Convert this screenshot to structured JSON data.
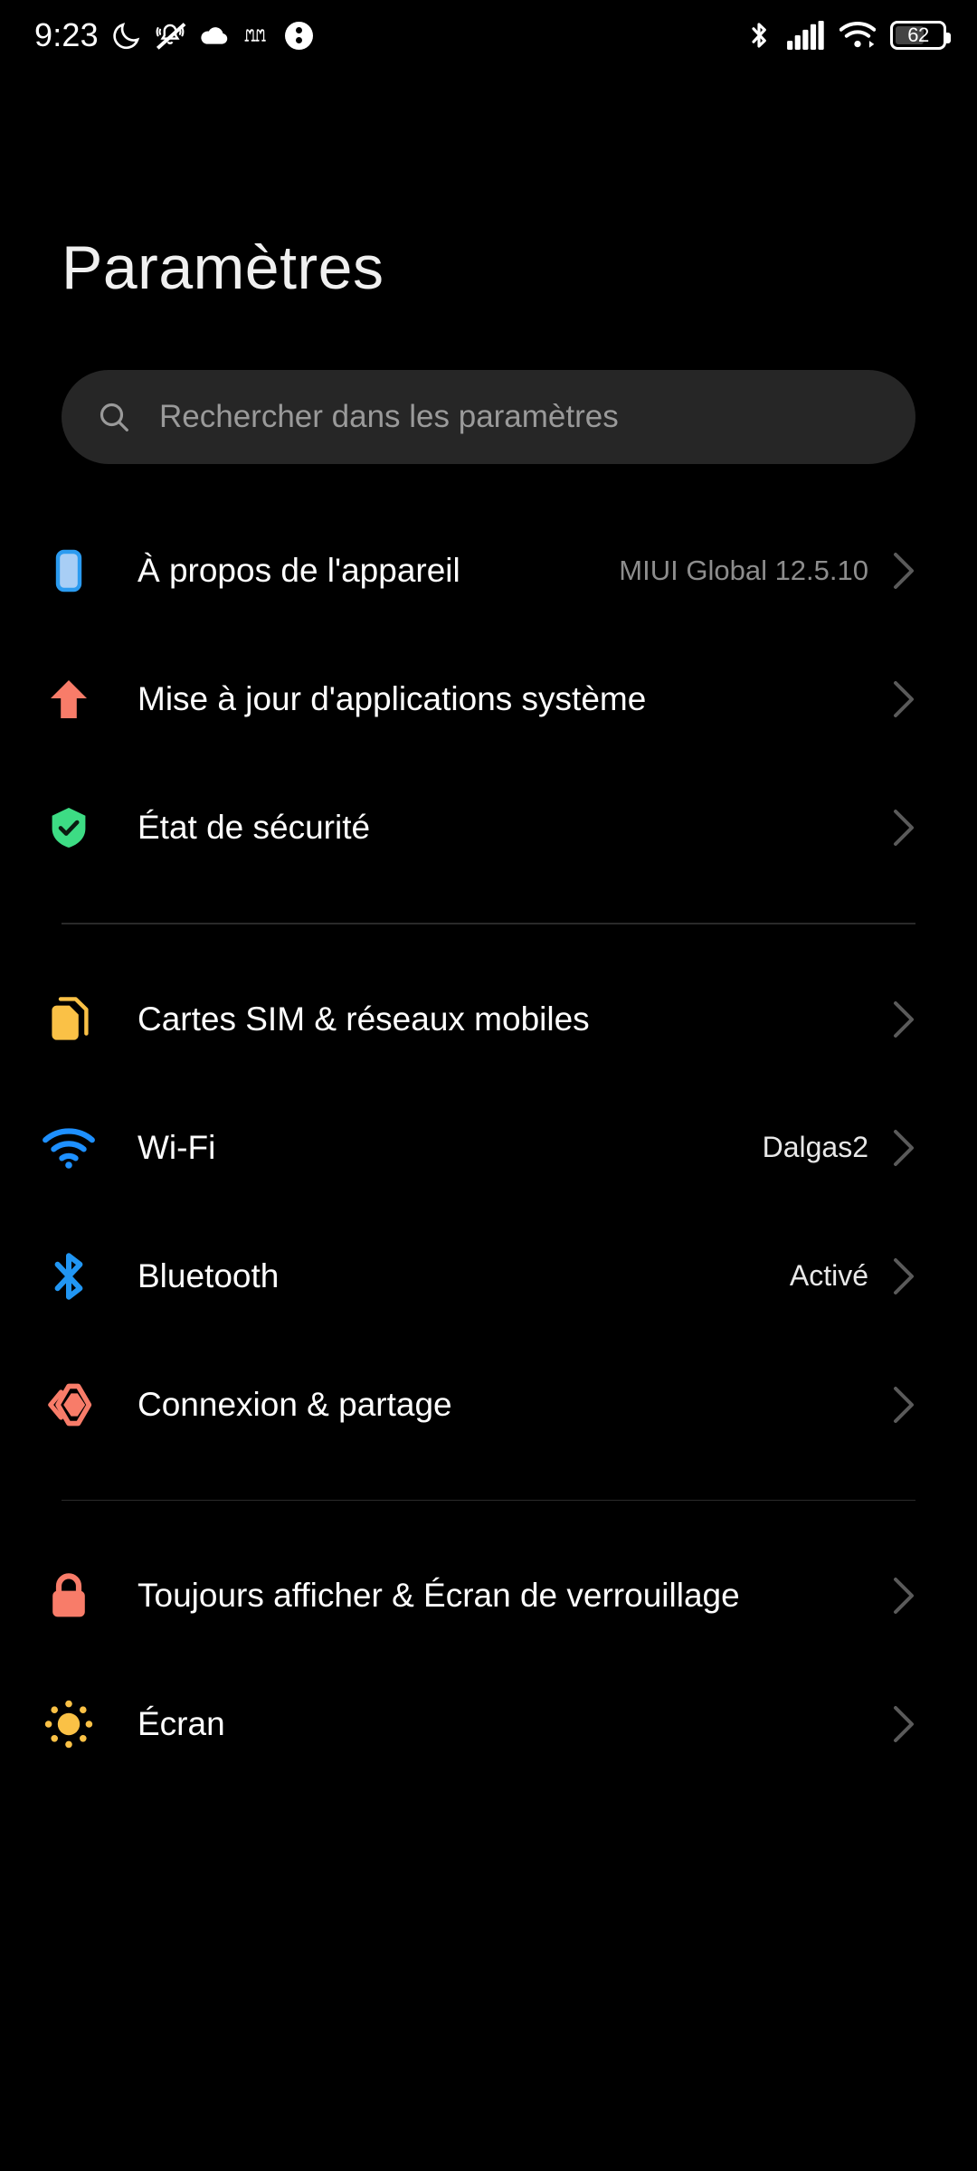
{
  "statusbar": {
    "time": "9:23",
    "battery_level": "62",
    "left_icons": [
      {
        "name": "moon-icon",
        "glyph": "☾"
      },
      {
        "name": "vibrate-off-icon",
        "glyph": "🔔"
      },
      {
        "name": "cloud-icon",
        "glyph": "☁"
      },
      {
        "name": "gothic-m-icon",
        "glyph": "𝔐"
      },
      {
        "name": "two-dots-circle-icon",
        "glyph": "⋮"
      }
    ],
    "right_icons": [
      {
        "name": "bluetooth-icon"
      },
      {
        "name": "signal-bars-icon"
      },
      {
        "name": "wifi-icon"
      },
      {
        "name": "battery-icon"
      }
    ]
  },
  "header": {
    "title": "Paramètres"
  },
  "search": {
    "placeholder": "Rechercher dans les paramètres",
    "value": ""
  },
  "colors": {
    "background": "#000000",
    "search_bg": "#262626",
    "title": "#f0f0f0",
    "row_title": "#ffffff",
    "row_value": "#8d8d8d",
    "row_value_bright": "#e8e8e8",
    "divider": "#2a2a2a",
    "chevron": "#5a5a5a",
    "icon_blue": "#a8cef5",
    "icon_blue_border": "#2b9bf0",
    "icon_salmon": "#f87c69",
    "icon_green": "#3ddc84",
    "icon_yellow": "#fac146",
    "icon_bluetooth": "#2196f3",
    "icon_wifi": "#1e90ff"
  },
  "groups": [
    {
      "id": "group-device",
      "items": [
        {
          "id": "about-device",
          "icon": "phone-icon",
          "label": "À propos de l'appareil",
          "value": "MIUI Global 12.5.10",
          "value_bright": false
        },
        {
          "id": "system-app-updater",
          "icon": "arrow-up-icon",
          "label": "Mise à jour d'applications système",
          "value": "",
          "value_bright": false
        },
        {
          "id": "security-status",
          "icon": "shield-check-icon",
          "label": "État de sécurité",
          "value": "",
          "value_bright": false
        }
      ]
    },
    {
      "id": "group-connectivity",
      "items": [
        {
          "id": "sim-cards-mobile-networks",
          "icon": "sim-card-icon",
          "label": "Cartes SIM & réseaux mobiles",
          "value": "",
          "value_bright": false
        },
        {
          "id": "wifi",
          "icon": "wifi-icon",
          "label": "Wi-Fi",
          "value": "Dalgas2",
          "value_bright": true
        },
        {
          "id": "bluetooth",
          "icon": "bluetooth-icon",
          "label": "Bluetooth",
          "value": "Activé",
          "value_bright": true
        },
        {
          "id": "connection-sharing",
          "icon": "connection-share-icon",
          "label": "Connexion & partage",
          "value": "",
          "value_bright": false
        }
      ]
    },
    {
      "id": "group-display",
      "items": [
        {
          "id": "always-on-lockscreen",
          "icon": "lock-icon",
          "label": "Toujours afficher & Écran de verrouillage",
          "value": "",
          "value_bright": false
        },
        {
          "id": "display",
          "icon": "sun-icon",
          "label": "Écran",
          "value": "",
          "value_bright": false
        }
      ]
    }
  ]
}
